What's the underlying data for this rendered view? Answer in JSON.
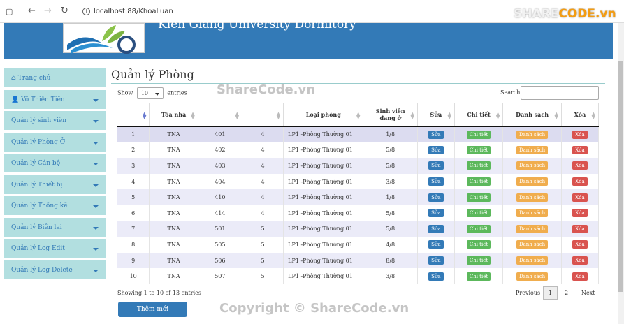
{
  "browser": {
    "back": "←",
    "forward": "→",
    "reload": "↻",
    "url": "localhost:88/KhoaLuan"
  },
  "logo": {
    "prefix": "SHARE",
    "suffix": "CODE.vn"
  },
  "header": {
    "title": "Kien Giang University Dormitory"
  },
  "sidebar": {
    "items": [
      {
        "label": "Trang chủ",
        "icon": "home-icon"
      },
      {
        "label": "Võ Thiện Tiên",
        "icon": "user-icon",
        "caret": true
      },
      {
        "label": "Quản lý sinh viên",
        "caret": true
      },
      {
        "label": "Quản lý Phòng Ở",
        "caret": true
      },
      {
        "label": "Quản lý Cán bộ",
        "caret": true
      },
      {
        "label": "Quản lý Thiết bị",
        "caret": true
      },
      {
        "label": "Quản lý Thống kê",
        "caret": true
      },
      {
        "label": "Quản lý Biên lai",
        "caret": true
      },
      {
        "label": "Quản lý Log Edit",
        "caret": true
      },
      {
        "label": "Quản lý Log Delete",
        "caret": true
      }
    ]
  },
  "page": {
    "title": "Quản lý Phòng"
  },
  "table_controls": {
    "show": "Show",
    "entries_value": "10",
    "entries": "entries",
    "search_label": "Search:"
  },
  "table": {
    "headers": [
      "",
      "Tòa nhà",
      "",
      "",
      "Loại phòng",
      "Sinh viên đang ở",
      "Sửa",
      "Chi tiết",
      "Danh sách",
      "Xóa"
    ],
    "actions": {
      "edit": "Sửa",
      "detail": "Chi tiết",
      "list": "Danh sách",
      "delete": "Xóa"
    },
    "rows": [
      {
        "stt": "1",
        "building": "TNA",
        "room": "401",
        "floor": "4",
        "type": "LP1 -Phòng Thường 01",
        "occ": "1/8"
      },
      {
        "stt": "2",
        "building": "TNA",
        "room": "402",
        "floor": "4",
        "type": "LP1 -Phòng Thường 01",
        "occ": "5/8"
      },
      {
        "stt": "3",
        "building": "TNA",
        "room": "403",
        "floor": "4",
        "type": "LP1 -Phòng Thường 01",
        "occ": "5/8"
      },
      {
        "stt": "4",
        "building": "TNA",
        "room": "404",
        "floor": "4",
        "type": "LP1 -Phòng Thường 01",
        "occ": "3/8"
      },
      {
        "stt": "5",
        "building": "TNA",
        "room": "410",
        "floor": "4",
        "type": "LP1 -Phòng Thường 01",
        "occ": "1/8"
      },
      {
        "stt": "6",
        "building": "TNA",
        "room": "414",
        "floor": "4",
        "type": "LP1 -Phòng Thường 01",
        "occ": "5/8"
      },
      {
        "stt": "7",
        "building": "TNA",
        "room": "501",
        "floor": "5",
        "type": "LP1 -Phòng Thường 01",
        "occ": "5/8"
      },
      {
        "stt": "8",
        "building": "TNA",
        "room": "505",
        "floor": "5",
        "type": "LP1 -Phòng Thường 01",
        "occ": "4/8"
      },
      {
        "stt": "9",
        "building": "TNA",
        "room": "506",
        "floor": "5",
        "type": "LP1 -Phòng Thường 01",
        "occ": "8/8"
      },
      {
        "stt": "10",
        "building": "TNA",
        "room": "507",
        "floor": "5",
        "type": "LP1 -Phòng Thường 01",
        "occ": "3/8"
      }
    ]
  },
  "footer": {
    "info": "Showing 1 to 10 of 13 entries",
    "previous": "Previous",
    "page1": "1",
    "page2": "2",
    "next": "Next",
    "add_button": "Thêm mới"
  },
  "watermarks": {
    "top": "ShareCode.vn",
    "bottom": "Copyright © ShareCode.vn"
  }
}
